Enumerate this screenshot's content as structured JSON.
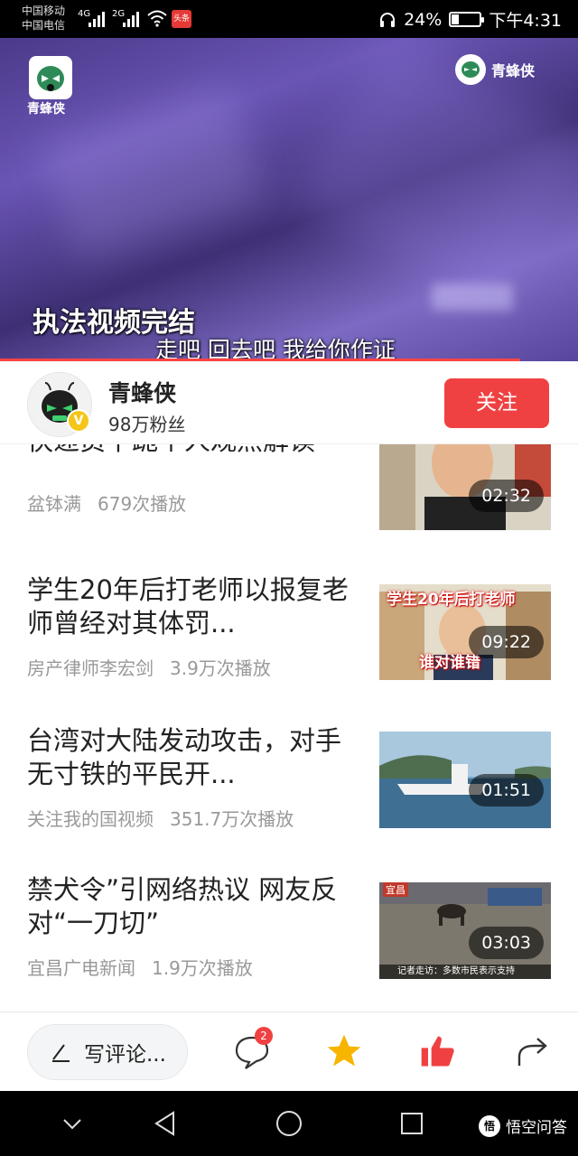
{
  "status_bar": {
    "carrier1": "中国移动",
    "carrier2": "中国电信",
    "net1": "4G",
    "net2": "2G",
    "notif_badge": "头条",
    "battery_percent": "24%",
    "battery_level": 0.24,
    "time": "下午4:31"
  },
  "video": {
    "logo_label": "青蜂侠",
    "watermark": "青蜂侠",
    "caption_main": "执法视频完结",
    "caption_sub": "走吧 回去吧 我给你作证",
    "progress": 0.9
  },
  "author": {
    "name": "青蜂侠",
    "fans": "98万粉丝",
    "verified": "V",
    "follow_label": "关注"
  },
  "videos": [
    {
      "title": "快递员下跪个人观点解读",
      "source": "盆钵满",
      "plays": "679次播放",
      "duration": "02:32"
    },
    {
      "title": "学生20年后打老师以报复老师曾经对其体罚...",
      "source": "房产律师李宏剑",
      "plays": "3.9万次播放",
      "duration": "09:22",
      "thumb_text_top": "学生20年后打老师",
      "thumb_text_bottom": "谁对谁错"
    },
    {
      "title": "台湾对大陆发动攻击，对手无寸铁的平民开...",
      "source": "关注我的国视频",
      "plays": "351.7万次播放",
      "duration": "01:51"
    },
    {
      "title": "禁犬令”引网络热议 网友反对“一刀切”",
      "source": "宜昌广电新闻",
      "plays": "1.9万次播放",
      "duration": "03:03",
      "thumb_text_top": "宜昌",
      "thumb_text_bottom": "记者走访：多数市民表示支持"
    }
  ],
  "action_bar": {
    "comment_placeholder": "写评论...",
    "comment_count": "2"
  },
  "nav_bar": {
    "brand": "悟空问答"
  },
  "icons": {
    "pencil": "pencil-icon",
    "comment": "comment-icon",
    "favorite": "star-icon",
    "like": "thumbs-up-icon",
    "share": "share-icon"
  },
  "colors": {
    "accent_red": "#f04142",
    "star_yellow": "#f7b500",
    "meta_gray": "#999999"
  }
}
